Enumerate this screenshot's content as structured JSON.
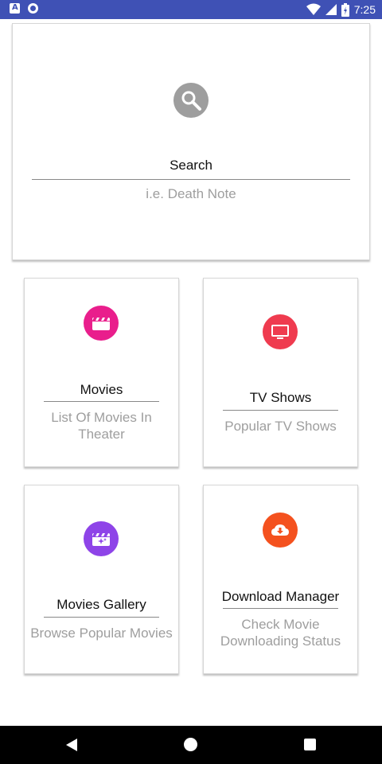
{
  "status_bar": {
    "time": "7:25",
    "icons": [
      "notification-a-icon",
      "record-icon",
      "wifi-icon",
      "signal-icon",
      "battery-icon"
    ]
  },
  "search": {
    "label": "Search",
    "placeholder": "i.e. Death Note",
    "icon": "search-icon",
    "icon_color": "#9e9e9e"
  },
  "cards": [
    {
      "title": "Movies",
      "subtitle_line1": "List Of Movies In",
      "subtitle_line2": "Theater",
      "icon": "movie-clapper-icon",
      "color": "#e91e8c"
    },
    {
      "title": "TV Shows",
      "subtitle": "Popular TV Shows",
      "icon": "tv-icon",
      "color": "#ef3b4f"
    },
    {
      "title": "Movies Gallery",
      "subtitle": "Browse Popular Movies",
      "icon": "movie-gallery-icon",
      "color": "#8e44e8"
    },
    {
      "title": "Download Manager",
      "subtitle_line1": "Check Movie",
      "subtitle_line2": "Downloading Status",
      "icon": "cloud-download-icon",
      "color": "#f4511e"
    }
  ],
  "nav_bar": {
    "icons": [
      "back-icon",
      "home-icon",
      "recents-icon"
    ]
  }
}
